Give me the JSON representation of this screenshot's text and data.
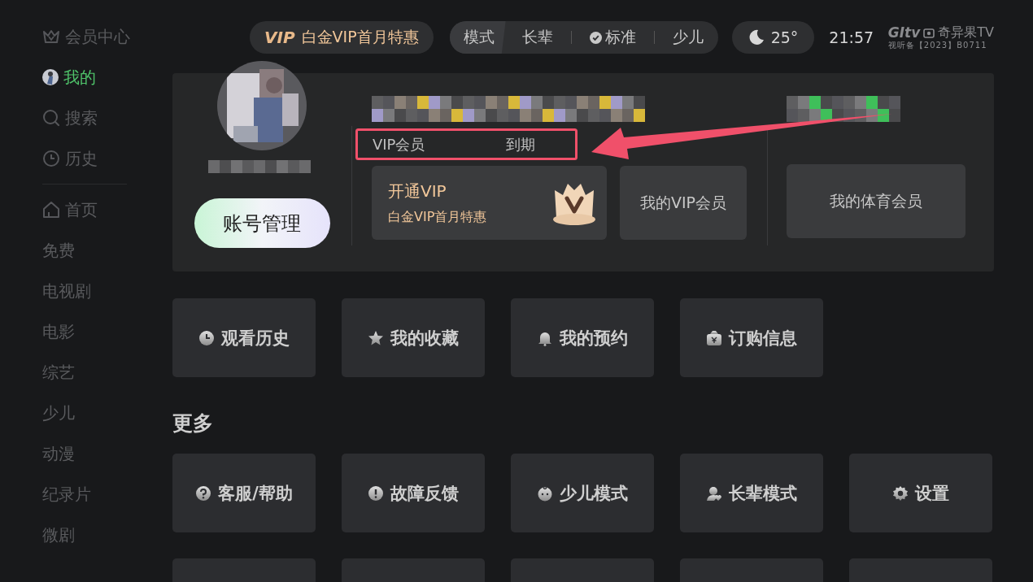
{
  "sidebar": {
    "top_items": [
      {
        "label": "会员中心",
        "selected": false
      },
      {
        "label": "我的",
        "selected": true
      },
      {
        "label": "搜索",
        "selected": false
      },
      {
        "label": "历史",
        "selected": false
      }
    ],
    "channel_items": [
      {
        "label": "首页",
        "selected": false
      },
      {
        "label": "免费",
        "selected": false
      },
      {
        "label": "电视剧",
        "selected": false
      },
      {
        "label": "电影",
        "selected": false
      },
      {
        "label": "综艺",
        "selected": false
      },
      {
        "label": "少儿",
        "selected": false
      },
      {
        "label": "动漫",
        "selected": false
      },
      {
        "label": "纪录片",
        "selected": false
      },
      {
        "label": "微剧",
        "selected": false
      }
    ]
  },
  "top_bar": {
    "promo": {
      "badge": "VIP",
      "label": "白金VIP首月特惠"
    },
    "mode_switch": {
      "label": "模式",
      "options": [
        {
          "label": "长辈",
          "selected": false
        },
        {
          "label": "标准",
          "selected": true
        },
        {
          "label": "少儿",
          "selected": false
        }
      ]
    },
    "weather": {
      "temperature": "25°"
    },
    "time": "21:57",
    "logo": {
      "brand": "GItv",
      "name": "奇异果TV",
      "license": "视听备【2023】B0711"
    }
  },
  "profile": {
    "account_button": "账号管理",
    "vip_status": {
      "prefix": "VIP会员",
      "suffix": "到期"
    },
    "open_vip": {
      "title": "开通VIP",
      "subtitle": "白金VIP首月特惠"
    },
    "my_vip_button": "我的VIP会员",
    "sports_button": "我的体育会员",
    "annotation": {
      "kind": "box-arrow"
    }
  },
  "shortcuts": [
    "观看历史",
    "我的收藏",
    "我的预约",
    "订购信息"
  ],
  "more": {
    "title": "更多",
    "items": [
      "客服/帮助",
      "故障反馈",
      "少儿模式",
      "长辈模式",
      "设置"
    ]
  }
}
